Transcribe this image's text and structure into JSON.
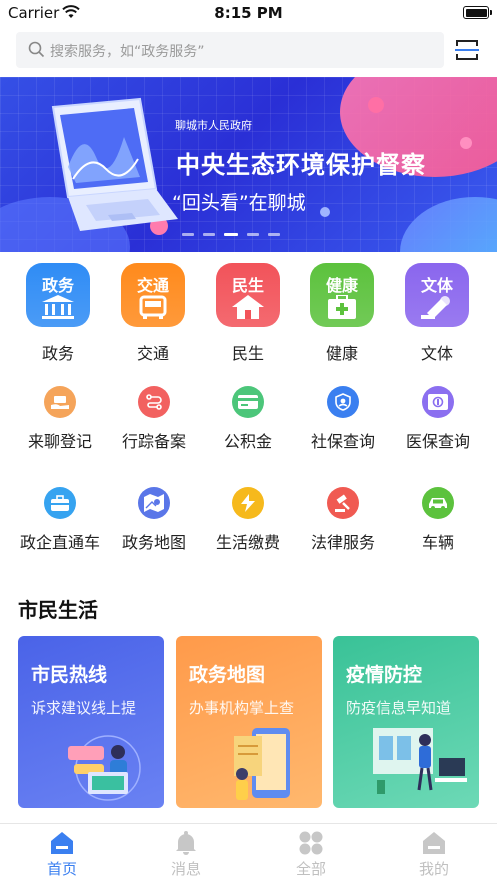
{
  "status_bar": {
    "carrier": "Carrier",
    "time": "8:15 PM"
  },
  "search": {
    "placeholder": "搜索服务，如“政务服务”"
  },
  "banner": {
    "subtitle": "聊城市人民政府",
    "title": "中央生态环境保护督察",
    "tagline": "“回头看”在聊城",
    "slide_count": 5,
    "active_slide": 2
  },
  "categories": [
    {
      "tile": "政务",
      "label": "政务",
      "color": "#2f8cf5"
    },
    {
      "tile": "交通",
      "label": "交通",
      "color": "#ff8a1c"
    },
    {
      "tile": "民生",
      "label": "民生",
      "color": "#f2535a"
    },
    {
      "tile": "健康",
      "label": "健康",
      "color": "#5cc23d"
    },
    {
      "tile": "文体",
      "label": "文体",
      "color": "#8a66ee"
    }
  ],
  "services_row1": [
    {
      "label": "来聊登记",
      "icon": "hand-card-icon",
      "color": "#f5a45a"
    },
    {
      "label": "行踪备案",
      "icon": "route-icon",
      "color": "#f26160"
    },
    {
      "label": "公积金",
      "icon": "card-icon",
      "color": "#4cc67a"
    },
    {
      "label": "社保查询",
      "icon": "shield-people-icon",
      "color": "#3a7ff0"
    },
    {
      "label": "医保查询",
      "icon": "medical-card-icon",
      "color": "#8b6ff0"
    }
  ],
  "services_row2": [
    {
      "label": "政企直通车",
      "icon": "briefcase-icon",
      "color": "#36a3f0"
    },
    {
      "label": "政务地图",
      "icon": "map-icon",
      "color": "#5a76e8"
    },
    {
      "label": "生活缴费",
      "icon": "lightning-icon",
      "color": "#f6b91c"
    },
    {
      "label": "法律服务",
      "icon": "gavel-icon",
      "color": "#f05a52"
    },
    {
      "label": "车辆",
      "icon": "car-icon",
      "color": "#5cc23d"
    }
  ],
  "section": {
    "title": "市民生活"
  },
  "cards": [
    {
      "title": "市民热线",
      "desc": "诉求建议线上提",
      "color_from": "#4a63e8",
      "color_to": "#6a7ff2"
    },
    {
      "title": "政务地图",
      "desc": "办事机构掌上查",
      "color_from": "#ff9a4a",
      "color_to": "#ffb56e"
    },
    {
      "title": "疫情防控",
      "desc": "防疫信息早知道",
      "color_from": "#3bc49a",
      "color_to": "#6ad6b4"
    }
  ],
  "tabs": [
    {
      "label": "首页",
      "icon": "home-icon",
      "active": true
    },
    {
      "label": "消息",
      "icon": "bell-icon",
      "active": false
    },
    {
      "label": "全部",
      "icon": "grid-icon",
      "active": false
    },
    {
      "label": "我的",
      "icon": "profile-icon",
      "active": false
    }
  ],
  "colors": {
    "accent": "#3a7ff0",
    "tab_inactive": "#c7c7c7"
  }
}
